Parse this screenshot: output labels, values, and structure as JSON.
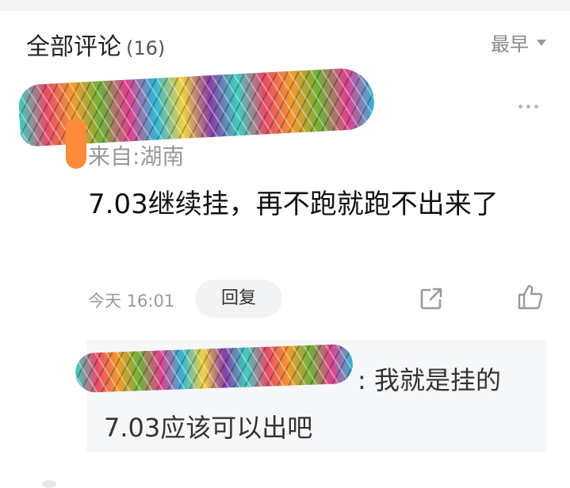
{
  "header": {
    "title": "全部评论",
    "count": "(16)",
    "sort_label": "最早"
  },
  "comment": {
    "location": "来自:湖南",
    "content": "7.03继续挂，再不跑就跑不出来了",
    "time": "今天 16:01",
    "reply_label": "回复",
    "icons": {
      "more": "more-dots-icon",
      "share": "share-icon",
      "like": "thumbs-up-icon"
    }
  },
  "subreply": {
    "line1": ": 我就是挂的",
    "line2": "7.03应该可以出吧"
  },
  "colors": {
    "text_primary": "#222222",
    "text_secondary": "#999999",
    "reply_bg": "#f2f3f5",
    "subreply_bg": "#f6f7f8"
  }
}
